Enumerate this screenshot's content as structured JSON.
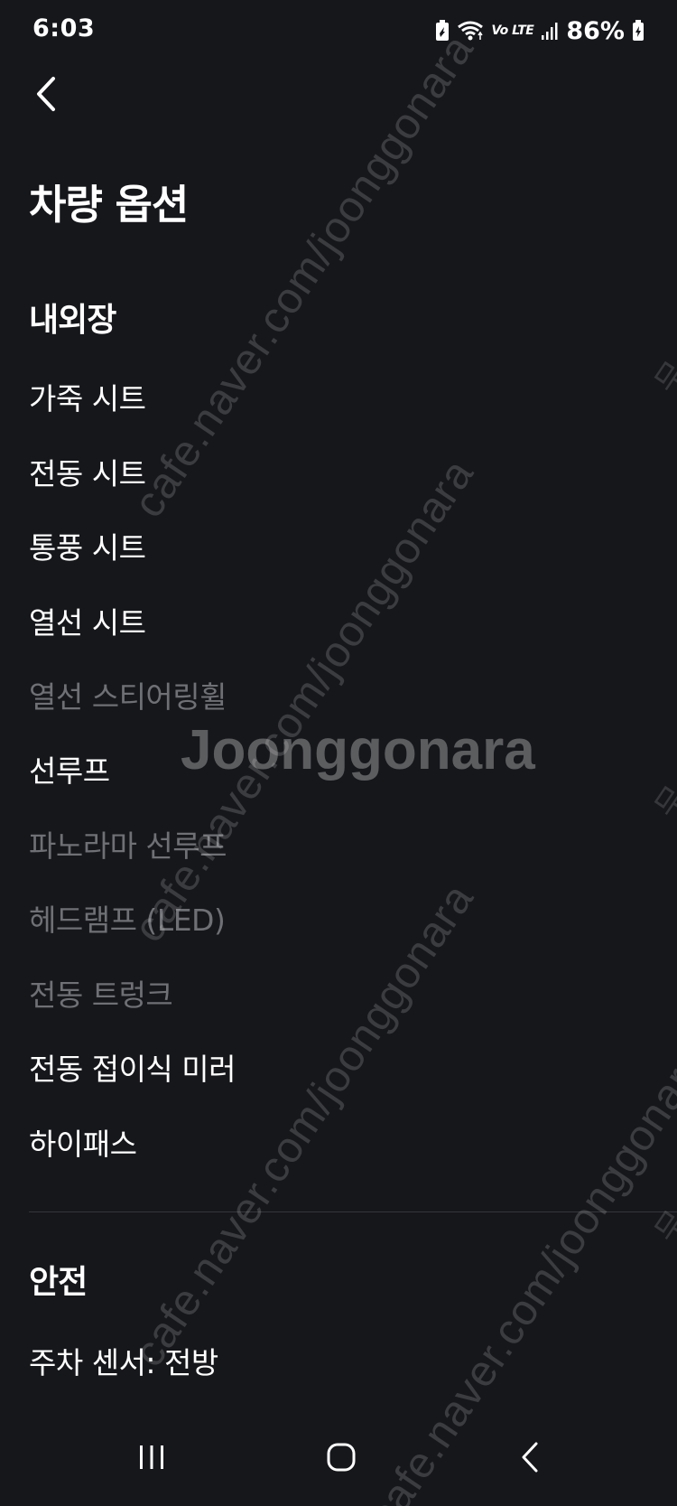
{
  "status_bar": {
    "time": "6:03",
    "lte_label": "Vo LTE",
    "battery_percent": "86%",
    "icons": [
      "battery-saver-icon",
      "wifi-icon",
      "volte-icon",
      "signal-icon",
      "battery-charging-icon"
    ]
  },
  "header": {
    "back_icon": "chevron-left-icon",
    "title": "차량 옵션"
  },
  "sections": {
    "interior_exterior": {
      "title": "내외장",
      "items": [
        {
          "label": "가죽 시트",
          "active": true
        },
        {
          "label": "전동 시트",
          "active": true
        },
        {
          "label": "통풍 시트",
          "active": true
        },
        {
          "label": "열선 시트",
          "active": true
        },
        {
          "label": "열선 스티어링휠",
          "active": false
        },
        {
          "label": "선루프",
          "active": true
        },
        {
          "label": "파노라마 선루프",
          "active": false
        },
        {
          "label": "헤드램프 (LED)",
          "active": false
        },
        {
          "label": "전동 트렁크",
          "active": false
        },
        {
          "label": "전동 접이식 미러",
          "active": true
        },
        {
          "label": "하이패스",
          "active": true
        }
      ]
    },
    "safety": {
      "title": "안전",
      "items": [
        {
          "label": "주차 센서: 전방",
          "active": true
        }
      ]
    }
  },
  "watermark": {
    "url_text": "cafe.naver.com/joonggonara",
    "logo_text": "Joonggonara",
    "edge_text": "무"
  },
  "nav_bar": {
    "icons": [
      "recent-apps-icon",
      "home-icon",
      "back-icon"
    ]
  },
  "colors": {
    "background": "#16171b",
    "text_active": "#ffffff",
    "text_inactive": "#6e7075",
    "divider": "#34363b"
  }
}
